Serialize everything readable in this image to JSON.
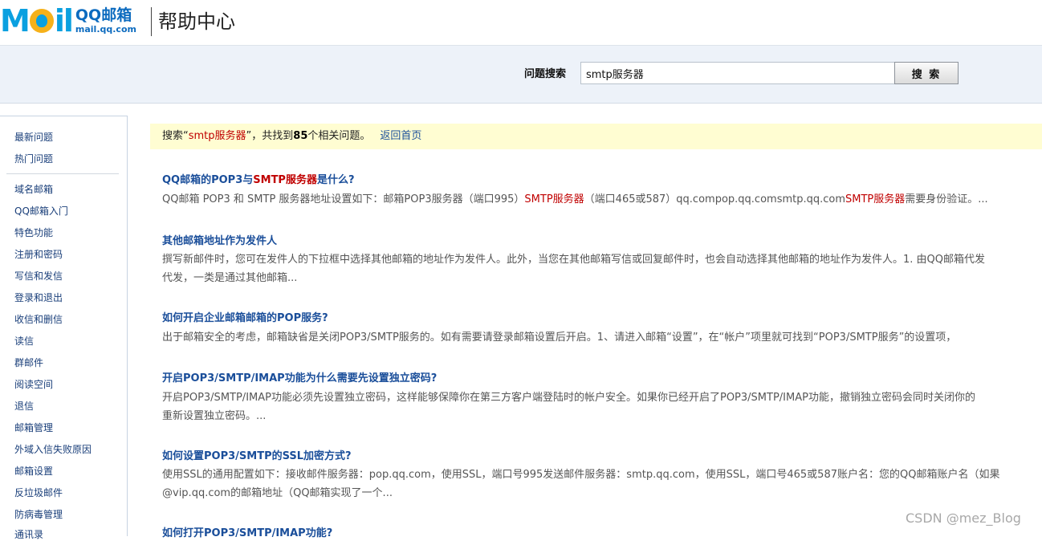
{
  "header": {
    "logo_mail": "M",
    "logo_il": "il",
    "logo_qq": "QQ邮箱",
    "logo_domain": "mail.qq.com",
    "help_title": "帮助中心"
  },
  "search": {
    "label": "问题搜索",
    "value": "smtp服务器",
    "button": "搜 索"
  },
  "sidebar": {
    "top_items": [
      "最新问题",
      "热门问题"
    ],
    "items": [
      "域名邮箱",
      "QQ邮箱入门",
      "特色功能",
      "注册和密码",
      "写信和发信",
      "登录和退出",
      "收信和删信",
      "读信",
      "群邮件",
      "阅读空间",
      "退信",
      "邮箱管理",
      "外域入信失败原因",
      "邮箱设置",
      "反垃圾邮件",
      "防病毒管理",
      "通讯录"
    ]
  },
  "notice": {
    "prefix": "搜索“",
    "query": "smtp服务器",
    "middle": "”，共找到",
    "count": "85",
    "suffix": "个相关问题。",
    "back_link": "返回首页"
  },
  "results": [
    {
      "title_a": "QQ邮箱的POP3与",
      "title_hl": "SMTP服务器",
      "title_b": "是什么?",
      "snippet_a": "QQ邮箱 POP3 和 SMTP 服务器地址设置如下：邮箱POP3服务器（端口995）",
      "snippet_hl1": "SMTP服务器",
      "snippet_b": "（端口465或587）qq.compop.qq.comsmtp.qq.com",
      "snippet_hl2": "SMTP服务器",
      "snippet_c": "需要身份验证。..."
    },
    {
      "title": "其他邮箱地址作为发件人",
      "line1": "撰写新邮件时，您可在发件人的下拉框中选择其他邮箱的地址作为发件人。此外，当您在其他邮箱写信或回复邮件时，也会自动选择其他邮箱的地址作为发件人。1. 由QQ邮箱代发",
      "line2": "代发，一类是通过其他邮箱..."
    },
    {
      "title": "如何开启企业邮箱邮箱的POP服务?",
      "line1": "出于邮箱安全的考虑，邮箱缺省是关闭POP3/SMTP服务的。如有需要请登录邮箱设置后开启。1、请进入邮箱“设置”，在“帐户”项里就可找到“POP3/SMTP服务”的设置项，"
    },
    {
      "title": "开启POP3/SMTP/IMAP功能为什么需要先设置独立密码?",
      "line1": "开启POP3/SMTP/IMAP功能必须先设置独立密码，这样能够保障你在第三方客户端登陆时的帐户安全。如果你已经开启了POP3/SMTP/IMAP功能，撤销独立密码会同时关闭你的",
      "line2": "重新设置独立密码。..."
    },
    {
      "title": "如何设置POP3/SMTP的SSL加密方式?",
      "line1": "使用SSL的通用配置如下：接收邮件服务器：pop.qq.com，使用SSL，端口号995发送邮件服务器：smtp.qq.com，使用SSL，端口号465或587账户名：您的QQ邮箱账户名（如果",
      "line2": "@vip.qq.com的邮箱地址（QQ邮箱实现了一个..."
    },
    {
      "title": "如何打开POP3/SMTP/IMAP功能?"
    }
  ],
  "watermark": "CSDN @mez_Blog"
}
